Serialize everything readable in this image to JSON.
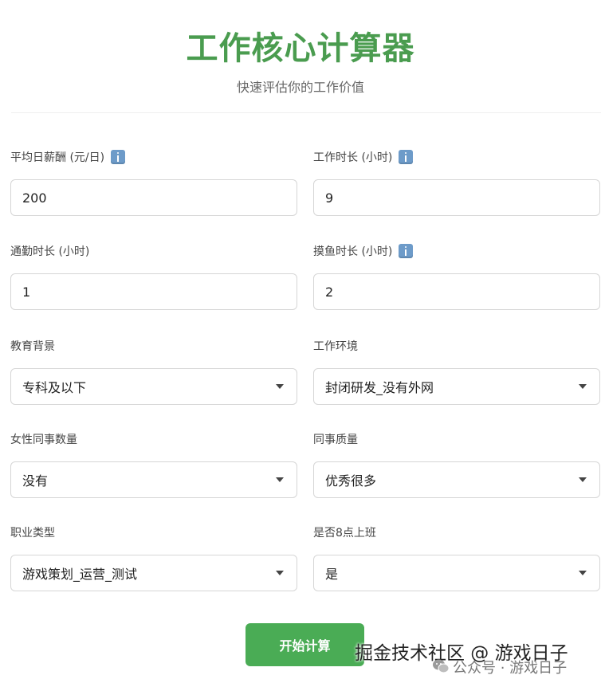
{
  "header": {
    "title": "工作核心计算器",
    "subtitle": "快速评估你的工作价值"
  },
  "fields": {
    "daily_salary": {
      "label": "平均日薪酬 (元/日)",
      "value": "200"
    },
    "work_hours": {
      "label": "工作时长 (小时)",
      "value": "9"
    },
    "commute_hours": {
      "label": "通勤时长 (小时)",
      "value": "1"
    },
    "slack_hours": {
      "label": "摸鱼时长 (小时)",
      "value": "2"
    },
    "education": {
      "label": "教育背景",
      "selected": "专科及以下"
    },
    "work_environment": {
      "label": "工作环境",
      "selected": "封闭研发_没有外网"
    },
    "female_colleagues": {
      "label": "女性同事数量",
      "selected": "没有"
    },
    "colleague_quality": {
      "label": "同事质量",
      "selected": "优秀很多"
    },
    "job_type": {
      "label": "职业类型",
      "selected": "游戏策划_运营_测试"
    },
    "start_at_8": {
      "label": "是否8点上班",
      "selected": "是"
    }
  },
  "actions": {
    "calculate_label": "开始计算"
  },
  "watermark": {
    "main": "掘金技术社区 @ 游戏日子",
    "sub": "公众号 · 游戏日子"
  },
  "colors": {
    "title_green": "#4a9c4f",
    "button_green": "#4aac55",
    "info_icon_blue": "#6d9bc9"
  }
}
